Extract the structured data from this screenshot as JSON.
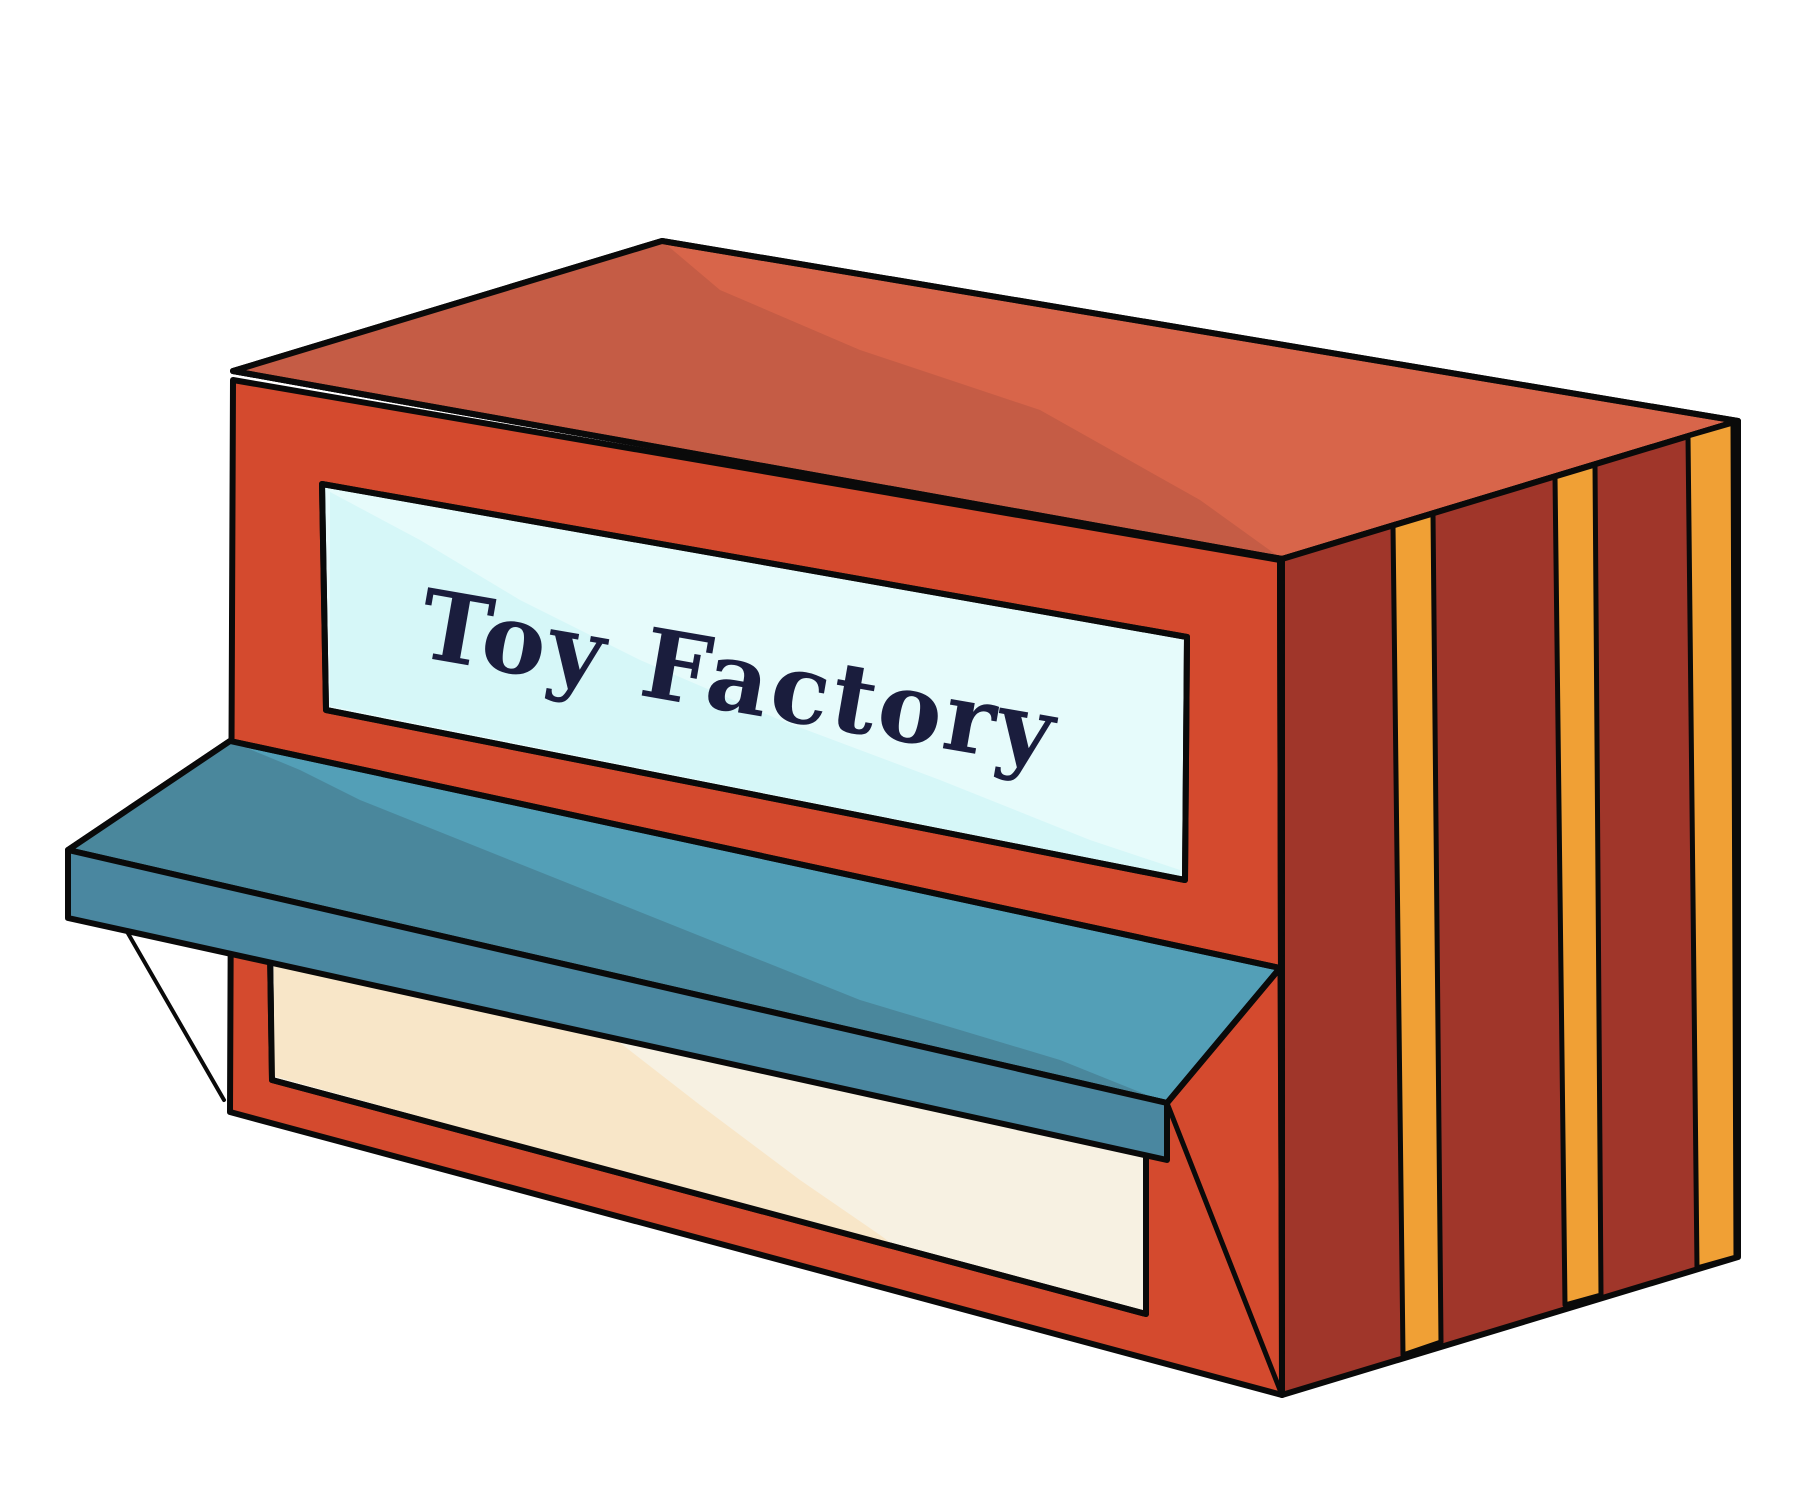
{
  "sign": {
    "text": "Toy Factory"
  },
  "colors": {
    "outline": "#0a0a0a",
    "front_wall": "#d44a2e",
    "roof": "#d8654a",
    "roof_shade": "#c55c45",
    "side_wall": "#a0362a",
    "side_stripe": "#f0a035",
    "sign_panel": "#e6fbfb",
    "sign_shade": "#d6f7f8",
    "sign_text": "#1a1d3d",
    "awning_top": "#539fb7",
    "awning_shade": "#4a879c",
    "awning_front": "#4a87a0",
    "shop_window": "#f7f1e2",
    "shop_window_shade": "#f8e6c8"
  },
  "icons": {
    "building": "toy-factory-building"
  }
}
